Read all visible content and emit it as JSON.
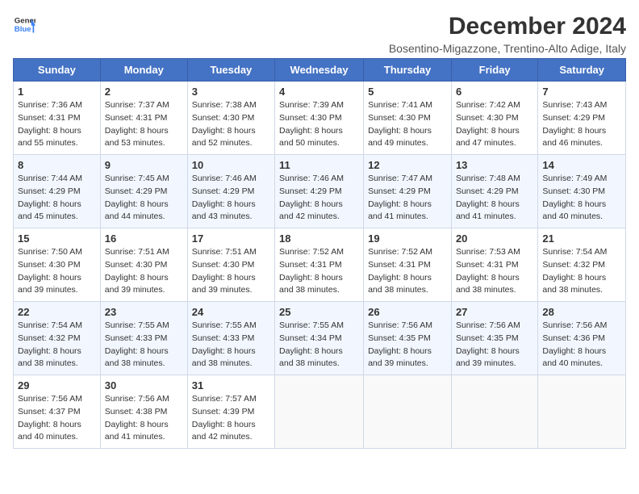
{
  "header": {
    "logo_line1": "General",
    "logo_line2": "Blue",
    "month_title": "December 2024",
    "location": "Bosentino-Migazzone, Trentino-Alto Adige, Italy"
  },
  "weekdays": [
    "Sunday",
    "Monday",
    "Tuesday",
    "Wednesday",
    "Thursday",
    "Friday",
    "Saturday"
  ],
  "weeks": [
    [
      {
        "day": 1,
        "sunrise": "7:36 AM",
        "sunset": "4:31 PM",
        "daylight": "8 hours and 55 minutes"
      },
      {
        "day": 2,
        "sunrise": "7:37 AM",
        "sunset": "4:31 PM",
        "daylight": "8 hours and 53 minutes"
      },
      {
        "day": 3,
        "sunrise": "7:38 AM",
        "sunset": "4:30 PM",
        "daylight": "8 hours and 52 minutes"
      },
      {
        "day": 4,
        "sunrise": "7:39 AM",
        "sunset": "4:30 PM",
        "daylight": "8 hours and 50 minutes"
      },
      {
        "day": 5,
        "sunrise": "7:41 AM",
        "sunset": "4:30 PM",
        "daylight": "8 hours and 49 minutes"
      },
      {
        "day": 6,
        "sunrise": "7:42 AM",
        "sunset": "4:30 PM",
        "daylight": "8 hours and 47 minutes"
      },
      {
        "day": 7,
        "sunrise": "7:43 AM",
        "sunset": "4:29 PM",
        "daylight": "8 hours and 46 minutes"
      }
    ],
    [
      {
        "day": 8,
        "sunrise": "7:44 AM",
        "sunset": "4:29 PM",
        "daylight": "8 hours and 45 minutes"
      },
      {
        "day": 9,
        "sunrise": "7:45 AM",
        "sunset": "4:29 PM",
        "daylight": "8 hours and 44 minutes"
      },
      {
        "day": 10,
        "sunrise": "7:46 AM",
        "sunset": "4:29 PM",
        "daylight": "8 hours and 43 minutes"
      },
      {
        "day": 11,
        "sunrise": "7:46 AM",
        "sunset": "4:29 PM",
        "daylight": "8 hours and 42 minutes"
      },
      {
        "day": 12,
        "sunrise": "7:47 AM",
        "sunset": "4:29 PM",
        "daylight": "8 hours and 41 minutes"
      },
      {
        "day": 13,
        "sunrise": "7:48 AM",
        "sunset": "4:29 PM",
        "daylight": "8 hours and 41 minutes"
      },
      {
        "day": 14,
        "sunrise": "7:49 AM",
        "sunset": "4:30 PM",
        "daylight": "8 hours and 40 minutes"
      }
    ],
    [
      {
        "day": 15,
        "sunrise": "7:50 AM",
        "sunset": "4:30 PM",
        "daylight": "8 hours and 39 minutes"
      },
      {
        "day": 16,
        "sunrise": "7:51 AM",
        "sunset": "4:30 PM",
        "daylight": "8 hours and 39 minutes"
      },
      {
        "day": 17,
        "sunrise": "7:51 AM",
        "sunset": "4:30 PM",
        "daylight": "8 hours and 39 minutes"
      },
      {
        "day": 18,
        "sunrise": "7:52 AM",
        "sunset": "4:31 PM",
        "daylight": "8 hours and 38 minutes"
      },
      {
        "day": 19,
        "sunrise": "7:52 AM",
        "sunset": "4:31 PM",
        "daylight": "8 hours and 38 minutes"
      },
      {
        "day": 20,
        "sunrise": "7:53 AM",
        "sunset": "4:31 PM",
        "daylight": "8 hours and 38 minutes"
      },
      {
        "day": 21,
        "sunrise": "7:54 AM",
        "sunset": "4:32 PM",
        "daylight": "8 hours and 38 minutes"
      }
    ],
    [
      {
        "day": 22,
        "sunrise": "7:54 AM",
        "sunset": "4:32 PM",
        "daylight": "8 hours and 38 minutes"
      },
      {
        "day": 23,
        "sunrise": "7:55 AM",
        "sunset": "4:33 PM",
        "daylight": "8 hours and 38 minutes"
      },
      {
        "day": 24,
        "sunrise": "7:55 AM",
        "sunset": "4:33 PM",
        "daylight": "8 hours and 38 minutes"
      },
      {
        "day": 25,
        "sunrise": "7:55 AM",
        "sunset": "4:34 PM",
        "daylight": "8 hours and 38 minutes"
      },
      {
        "day": 26,
        "sunrise": "7:56 AM",
        "sunset": "4:35 PM",
        "daylight": "8 hours and 39 minutes"
      },
      {
        "day": 27,
        "sunrise": "7:56 AM",
        "sunset": "4:35 PM",
        "daylight": "8 hours and 39 minutes"
      },
      {
        "day": 28,
        "sunrise": "7:56 AM",
        "sunset": "4:36 PM",
        "daylight": "8 hours and 40 minutes"
      }
    ],
    [
      {
        "day": 29,
        "sunrise": "7:56 AM",
        "sunset": "4:37 PM",
        "daylight": "8 hours and 40 minutes"
      },
      {
        "day": 30,
        "sunrise": "7:56 AM",
        "sunset": "4:38 PM",
        "daylight": "8 hours and 41 minutes"
      },
      {
        "day": 31,
        "sunrise": "7:57 AM",
        "sunset": "4:39 PM",
        "daylight": "8 hours and 42 minutes"
      },
      null,
      null,
      null,
      null
    ]
  ]
}
